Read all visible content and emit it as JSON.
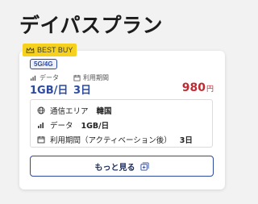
{
  "page": {
    "title": "デイパスプラン"
  },
  "plan": {
    "badge": "BEST BUY",
    "network": "5G/4G",
    "data_label": "データ",
    "data_value": "1GB/日",
    "period_label": "利用期間",
    "period_value": "3日",
    "price": "980",
    "price_unit": "円",
    "details": [
      {
        "icon": "globe-icon",
        "label": "通信エリア",
        "value": "韓国"
      },
      {
        "icon": "signal-bars-icon",
        "label": "データ",
        "value": "1GB/日"
      },
      {
        "icon": "calendar-icon",
        "label": "利用期間（アクティベーション後）",
        "value": "3日"
      }
    ],
    "more_label": "もっと見る"
  },
  "colors": {
    "accent": "#2b4aa0",
    "price": "#c22a32",
    "badge": "#f6d21e"
  }
}
